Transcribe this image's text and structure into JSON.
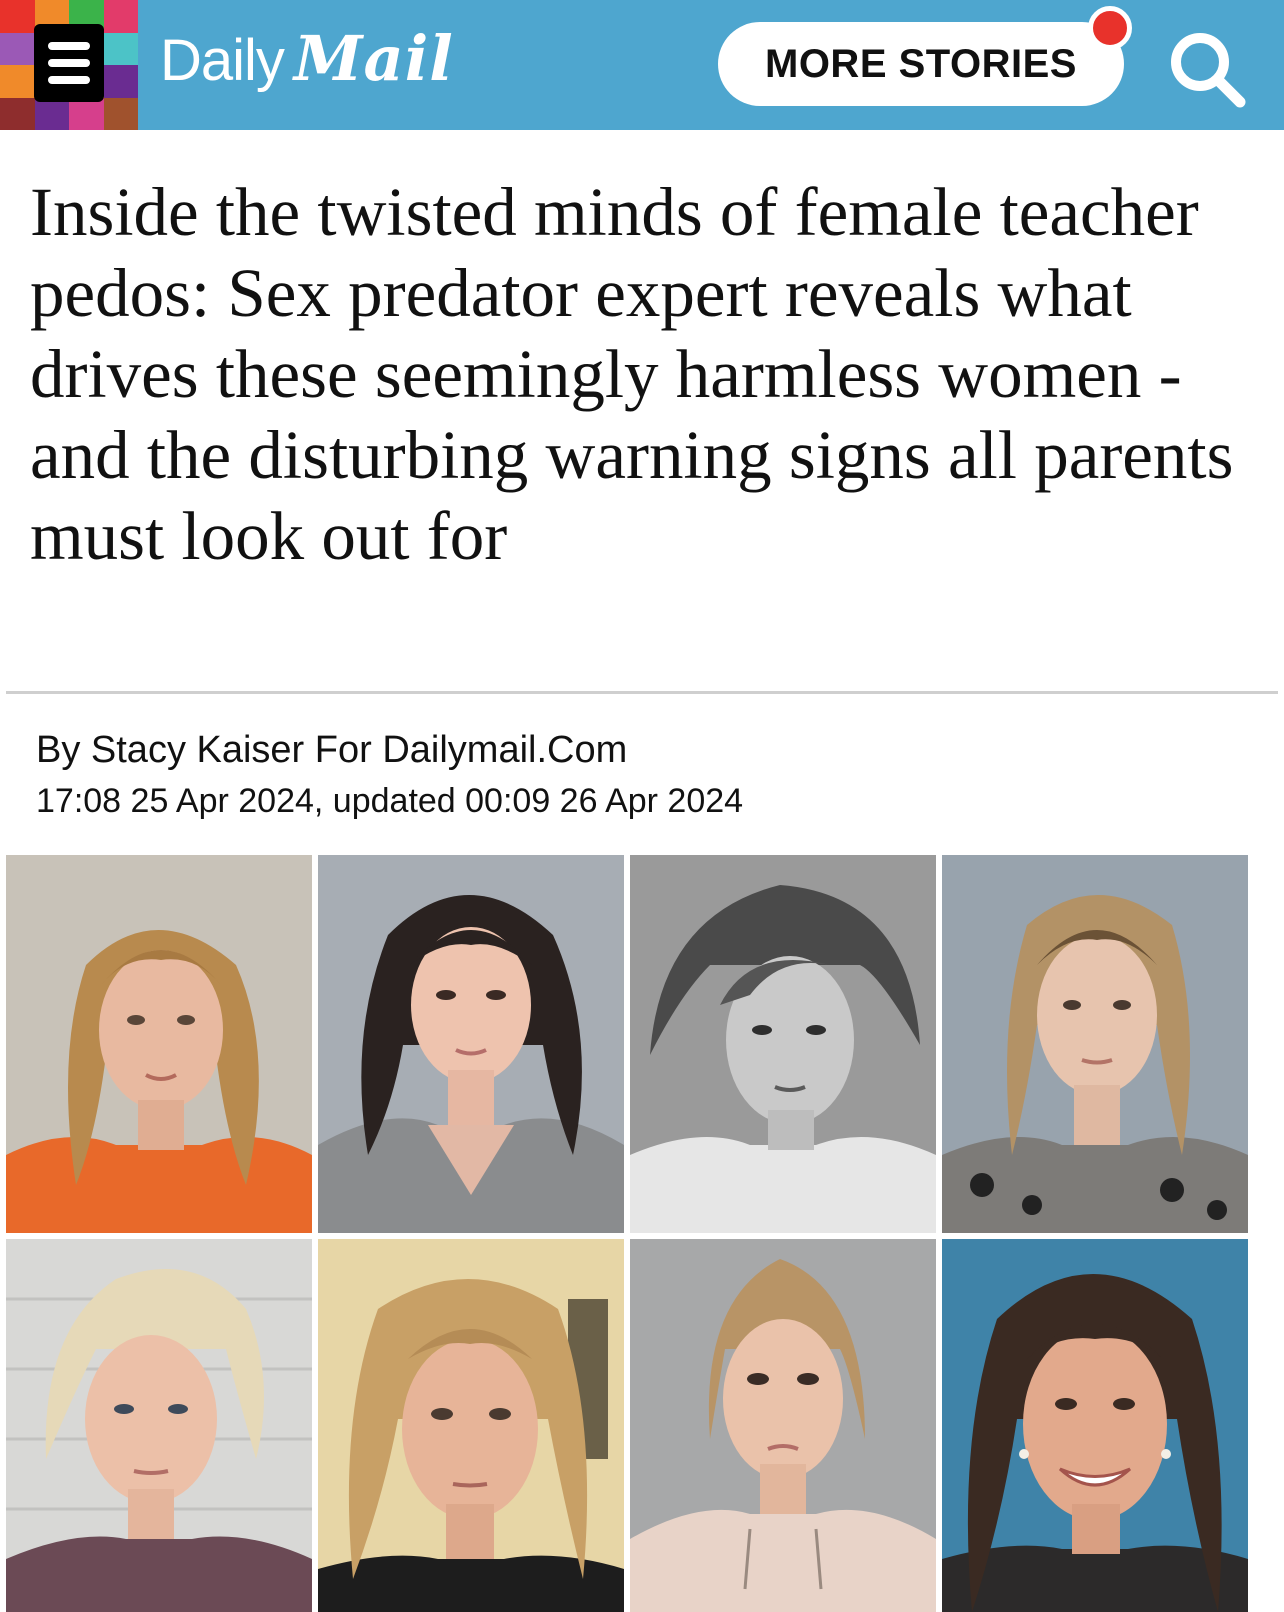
{
  "header": {
    "logo_daily": "Daily",
    "logo_mail": "Mail",
    "more_stories_label": "MORE STORIES",
    "menu_icon": "hamburger-menu-icon",
    "search_icon": "search-icon",
    "colors": {
      "header_bg": "#4ea6cf",
      "notification_dot": "#e8322b"
    }
  },
  "article": {
    "headline": "Inside the twisted minds of female teacher pedos: Sex predator expert reveals what drives these seemingly harmless women - and the disturbing warning signs all parents must look out for",
    "byline": "By Stacy Kaiser For Dailymail.Com",
    "dateline": "17:08 25 Apr 2024, updated 00:09 26 Apr 2024"
  }
}
